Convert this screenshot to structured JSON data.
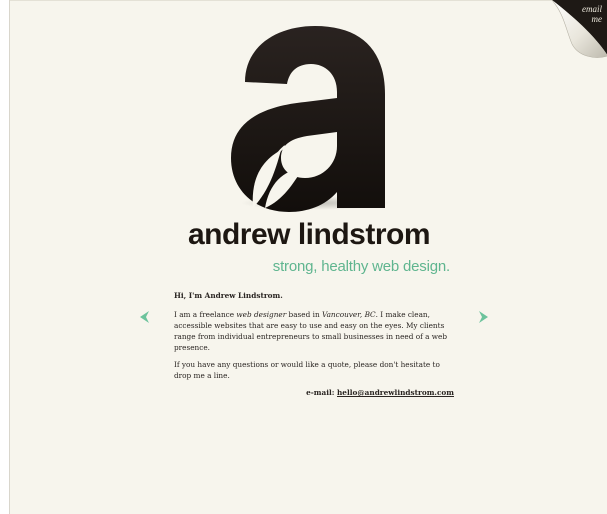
{
  "header": {
    "logo_icon": "letter-a-leaf-logo",
    "site_name": "andrew lindstrom",
    "tagline": "strong, healthy web design."
  },
  "corner_tab": {
    "line1": "email",
    "line2": "me"
  },
  "nav": {
    "prev_icon": "chevron-left-icon",
    "next_icon": "chevron-right-icon"
  },
  "content": {
    "greeting": "Hi, I'm Andrew Lindstrom.",
    "p1_a": "I am a freelance ",
    "p1_em1": "web designer",
    "p1_b": " based in ",
    "p1_em2": "Vancouver, BC",
    "p1_c": ". I make clean, accessible websites that are easy to use and easy on the eyes. My clients range from individual entrepreneurs to small businesses in need of a web presence.",
    "p2": "If you have any questions or would like a quote, please don't hesitate to drop me a line.",
    "email_label": "e-mail: ",
    "email_address": "hello@andrewlindstrom.com"
  },
  "colors": {
    "background": "#f7f5ed",
    "logo": "#1d1712",
    "accent_green": "#5fb58f",
    "text": "#2a2522"
  }
}
